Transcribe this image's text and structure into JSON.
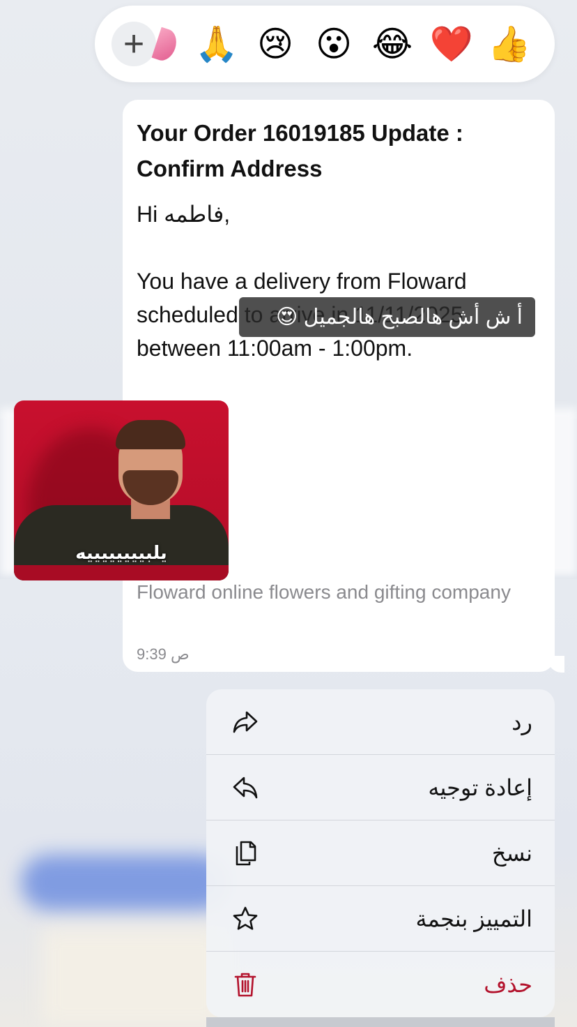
{
  "reactions": {
    "add_symbol": "+",
    "emojis": [
      "🙏",
      "😢",
      "😮",
      "😂",
      "❤️",
      "👍"
    ]
  },
  "message": {
    "title": "Your Order 16019185 Update : Confirm Address",
    "greeting": "Hi فاطمه,",
    "body": "You have a delivery from Floward scheduled to arrive in 11/11/2025 between 11:00am - 1:00pm.",
    "footer": "Floward online flowers and gifting company",
    "time": "9:39 ص"
  },
  "caption": "أ ش أش هالصبح هالجميل 😍",
  "sticker": {
    "text": "يلبييييييييه"
  },
  "menu": {
    "items": [
      {
        "label": "رد",
        "icon": "reply-icon"
      },
      {
        "label": "إعادة توجيه",
        "icon": "forward-icon"
      },
      {
        "label": "نسخ",
        "icon": "copy-icon"
      },
      {
        "label": "التمييز بنجمة",
        "icon": "star-icon"
      },
      {
        "label": "حذف",
        "icon": "trash-icon"
      }
    ]
  },
  "colors": {
    "danger": "#b3122c",
    "footer_text": "#8a8a8e",
    "sticker_red": "#c8102e"
  }
}
